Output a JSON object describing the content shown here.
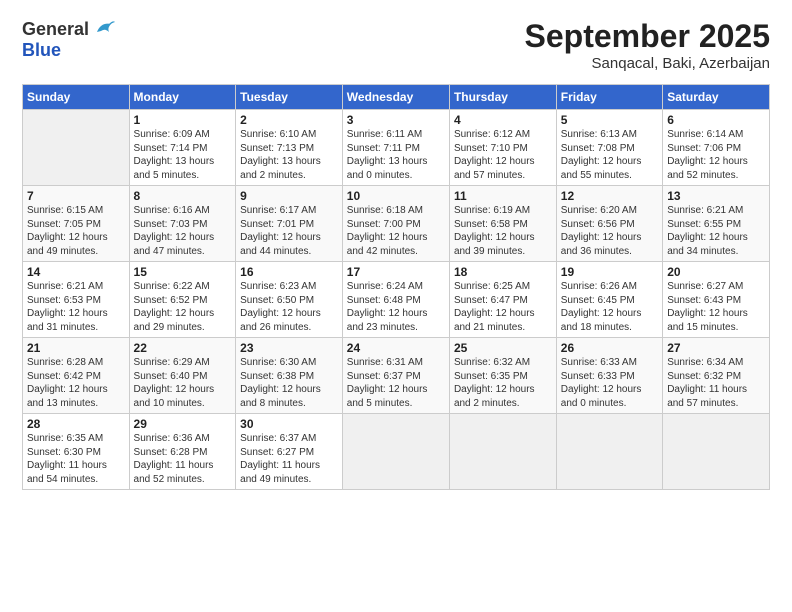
{
  "logo": {
    "general": "General",
    "blue": "Blue"
  },
  "header": {
    "month_year": "September 2025",
    "location": "Sanqacal, Baki, Azerbaijan"
  },
  "days_of_week": [
    "Sunday",
    "Monday",
    "Tuesday",
    "Wednesday",
    "Thursday",
    "Friday",
    "Saturday"
  ],
  "weeks": [
    [
      {
        "day": "",
        "sunrise": "",
        "sunset": "",
        "daylight": ""
      },
      {
        "day": "1",
        "sunrise": "Sunrise: 6:09 AM",
        "sunset": "Sunset: 7:14 PM",
        "daylight": "Daylight: 13 hours and 5 minutes."
      },
      {
        "day": "2",
        "sunrise": "Sunrise: 6:10 AM",
        "sunset": "Sunset: 7:13 PM",
        "daylight": "Daylight: 13 hours and 2 minutes."
      },
      {
        "day": "3",
        "sunrise": "Sunrise: 6:11 AM",
        "sunset": "Sunset: 7:11 PM",
        "daylight": "Daylight: 13 hours and 0 minutes."
      },
      {
        "day": "4",
        "sunrise": "Sunrise: 6:12 AM",
        "sunset": "Sunset: 7:10 PM",
        "daylight": "Daylight: 12 hours and 57 minutes."
      },
      {
        "day": "5",
        "sunrise": "Sunrise: 6:13 AM",
        "sunset": "Sunset: 7:08 PM",
        "daylight": "Daylight: 12 hours and 55 minutes."
      },
      {
        "day": "6",
        "sunrise": "Sunrise: 6:14 AM",
        "sunset": "Sunset: 7:06 PM",
        "daylight": "Daylight: 12 hours and 52 minutes."
      }
    ],
    [
      {
        "day": "7",
        "sunrise": "Sunrise: 6:15 AM",
        "sunset": "Sunset: 7:05 PM",
        "daylight": "Daylight: 12 hours and 49 minutes."
      },
      {
        "day": "8",
        "sunrise": "Sunrise: 6:16 AM",
        "sunset": "Sunset: 7:03 PM",
        "daylight": "Daylight: 12 hours and 47 minutes."
      },
      {
        "day": "9",
        "sunrise": "Sunrise: 6:17 AM",
        "sunset": "Sunset: 7:01 PM",
        "daylight": "Daylight: 12 hours and 44 minutes."
      },
      {
        "day": "10",
        "sunrise": "Sunrise: 6:18 AM",
        "sunset": "Sunset: 7:00 PM",
        "daylight": "Daylight: 12 hours and 42 minutes."
      },
      {
        "day": "11",
        "sunrise": "Sunrise: 6:19 AM",
        "sunset": "Sunset: 6:58 PM",
        "daylight": "Daylight: 12 hours and 39 minutes."
      },
      {
        "day": "12",
        "sunrise": "Sunrise: 6:20 AM",
        "sunset": "Sunset: 6:56 PM",
        "daylight": "Daylight: 12 hours and 36 minutes."
      },
      {
        "day": "13",
        "sunrise": "Sunrise: 6:21 AM",
        "sunset": "Sunset: 6:55 PM",
        "daylight": "Daylight: 12 hours and 34 minutes."
      }
    ],
    [
      {
        "day": "14",
        "sunrise": "Sunrise: 6:21 AM",
        "sunset": "Sunset: 6:53 PM",
        "daylight": "Daylight: 12 hours and 31 minutes."
      },
      {
        "day": "15",
        "sunrise": "Sunrise: 6:22 AM",
        "sunset": "Sunset: 6:52 PM",
        "daylight": "Daylight: 12 hours and 29 minutes."
      },
      {
        "day": "16",
        "sunrise": "Sunrise: 6:23 AM",
        "sunset": "Sunset: 6:50 PM",
        "daylight": "Daylight: 12 hours and 26 minutes."
      },
      {
        "day": "17",
        "sunrise": "Sunrise: 6:24 AM",
        "sunset": "Sunset: 6:48 PM",
        "daylight": "Daylight: 12 hours and 23 minutes."
      },
      {
        "day": "18",
        "sunrise": "Sunrise: 6:25 AM",
        "sunset": "Sunset: 6:47 PM",
        "daylight": "Daylight: 12 hours and 21 minutes."
      },
      {
        "day": "19",
        "sunrise": "Sunrise: 6:26 AM",
        "sunset": "Sunset: 6:45 PM",
        "daylight": "Daylight: 12 hours and 18 minutes."
      },
      {
        "day": "20",
        "sunrise": "Sunrise: 6:27 AM",
        "sunset": "Sunset: 6:43 PM",
        "daylight": "Daylight: 12 hours and 15 minutes."
      }
    ],
    [
      {
        "day": "21",
        "sunrise": "Sunrise: 6:28 AM",
        "sunset": "Sunset: 6:42 PM",
        "daylight": "Daylight: 12 hours and 13 minutes."
      },
      {
        "day": "22",
        "sunrise": "Sunrise: 6:29 AM",
        "sunset": "Sunset: 6:40 PM",
        "daylight": "Daylight: 12 hours and 10 minutes."
      },
      {
        "day": "23",
        "sunrise": "Sunrise: 6:30 AM",
        "sunset": "Sunset: 6:38 PM",
        "daylight": "Daylight: 12 hours and 8 minutes."
      },
      {
        "day": "24",
        "sunrise": "Sunrise: 6:31 AM",
        "sunset": "Sunset: 6:37 PM",
        "daylight": "Daylight: 12 hours and 5 minutes."
      },
      {
        "day": "25",
        "sunrise": "Sunrise: 6:32 AM",
        "sunset": "Sunset: 6:35 PM",
        "daylight": "Daylight: 12 hours and 2 minutes."
      },
      {
        "day": "26",
        "sunrise": "Sunrise: 6:33 AM",
        "sunset": "Sunset: 6:33 PM",
        "daylight": "Daylight: 12 hours and 0 minutes."
      },
      {
        "day": "27",
        "sunrise": "Sunrise: 6:34 AM",
        "sunset": "Sunset: 6:32 PM",
        "daylight": "Daylight: 11 hours and 57 minutes."
      }
    ],
    [
      {
        "day": "28",
        "sunrise": "Sunrise: 6:35 AM",
        "sunset": "Sunset: 6:30 PM",
        "daylight": "Daylight: 11 hours and 54 minutes."
      },
      {
        "day": "29",
        "sunrise": "Sunrise: 6:36 AM",
        "sunset": "Sunset: 6:28 PM",
        "daylight": "Daylight: 11 hours and 52 minutes."
      },
      {
        "day": "30",
        "sunrise": "Sunrise: 6:37 AM",
        "sunset": "Sunset: 6:27 PM",
        "daylight": "Daylight: 11 hours and 49 minutes."
      },
      {
        "day": "",
        "sunrise": "",
        "sunset": "",
        "daylight": ""
      },
      {
        "day": "",
        "sunrise": "",
        "sunset": "",
        "daylight": ""
      },
      {
        "day": "",
        "sunrise": "",
        "sunset": "",
        "daylight": ""
      },
      {
        "day": "",
        "sunrise": "",
        "sunset": "",
        "daylight": ""
      }
    ]
  ]
}
